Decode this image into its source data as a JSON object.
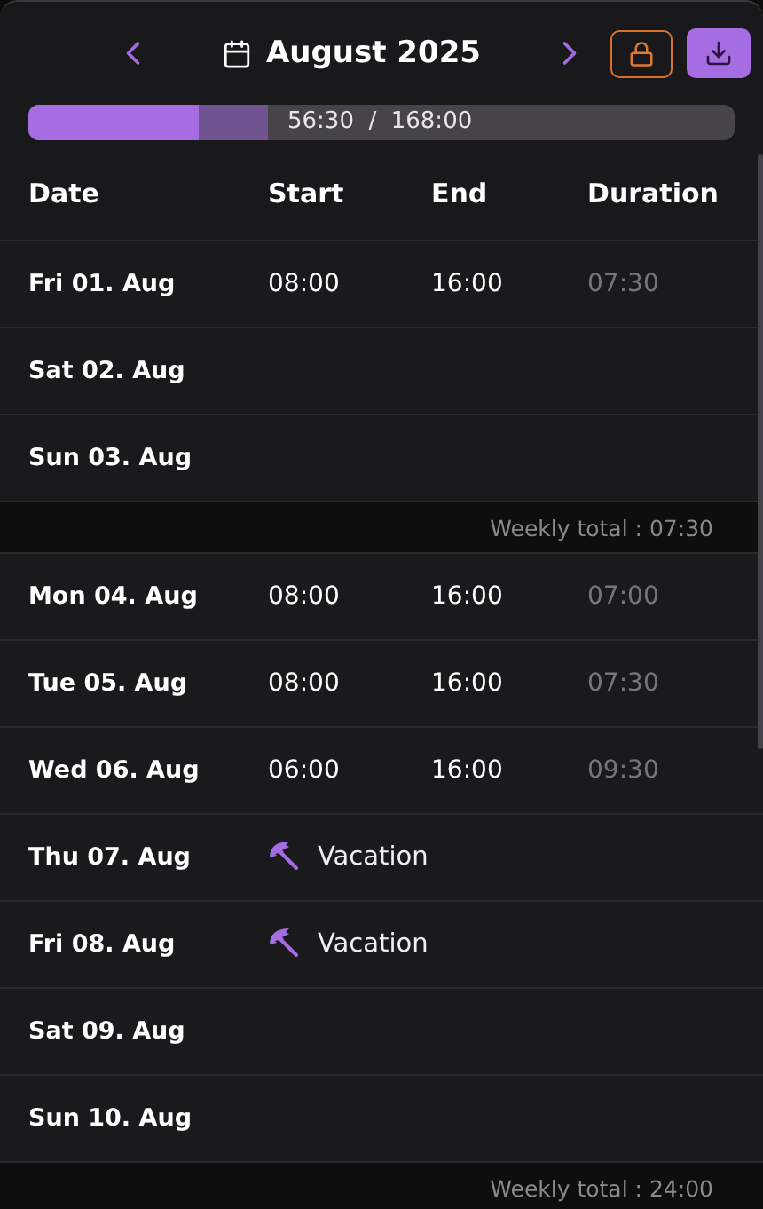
{
  "header": {
    "title": "August 2025",
    "locked": false
  },
  "progress": {
    "worked": {
      "level": 0.24
    },
    "level": 0.34,
    "reading": "56:30  /  168:00"
  },
  "columns": [
    "Date",
    "Start",
    "End",
    "Duration"
  ],
  "rows": [
    {
      "kind": "work",
      "date": "Fri 01. Aug",
      "start": "08:00",
      "end": "16:00",
      "duration": "07:30"
    },
    {
      "kind": "empty",
      "date": "Sat 02. Aug"
    },
    {
      "kind": "empty",
      "date": "Sun 03. Aug"
    },
    {
      "kind": "total",
      "text": "Weekly total : 07:30"
    },
    {
      "kind": "work",
      "date": "Mon 04. Aug",
      "start": "08:00",
      "end": "16:00",
      "duration": "07:00"
    },
    {
      "kind": "work",
      "date": "Tue 05. Aug",
      "start": "08:00",
      "end": "16:00",
      "duration": "07:30"
    },
    {
      "kind": "work",
      "date": "Wed 06. Aug",
      "start": "06:00",
      "end": "16:00",
      "duration": "09:30"
    },
    {
      "kind": "vacation",
      "date": "Thu 07. Aug",
      "label": "Vacation"
    },
    {
      "kind": "vacation",
      "date": "Fri 08. Aug",
      "label": "Vacation"
    },
    {
      "kind": "empty",
      "date": "Sat 09. Aug"
    },
    {
      "kind": "empty",
      "date": "Sun 10. Aug"
    },
    {
      "kind": "total",
      "text": "Weekly total : 24:00"
    }
  ]
}
